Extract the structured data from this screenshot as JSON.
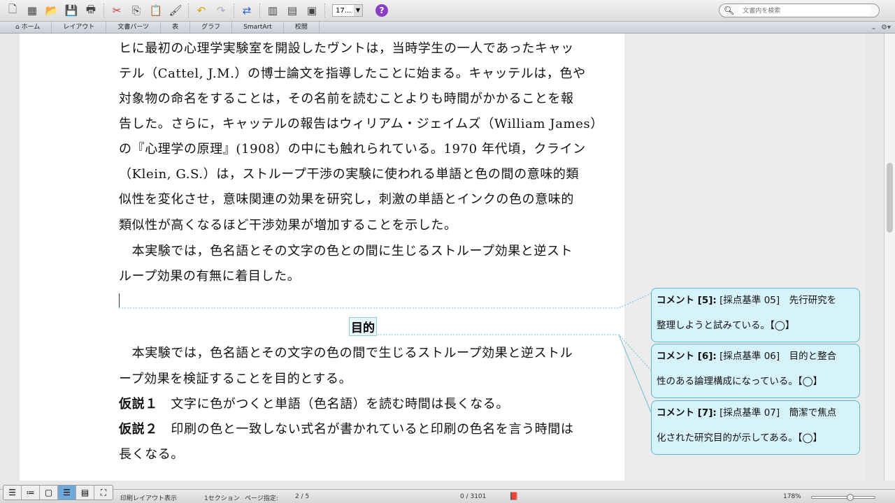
{
  "toolbar": {
    "font_size": "17...",
    "search_placeholder": "文書内を検索"
  },
  "ribbon": {
    "tabs": [
      "ホーム",
      "レイアウト",
      "文書パーツ",
      "表",
      "グラフ",
      "SmartArt",
      "校閲"
    ]
  },
  "document": {
    "lines": [
      "ヒに最初の心理学実験室を開設したヴントは，当時学生の一人であったキャッ",
      "テル（Cattel, J.M.）の博士論文を指導したことに始まる。キャッテルは，色や",
      "対象物の命名をすることは，その名前を読むことよりも時間がかかることを報",
      "告した。さらに，キャッテルの報告はウィリアム・ジェイムズ（William James）",
      "の『心理学の原理』(1908）の中にも触れられている。1970 年代頃，クライン",
      "（Klein, G.S.）は，ストループ干渉の実験に使われる単語と色の間の意味的類",
      "似性を変化させ，意味関連の効果を研究し，刺激の単語とインクの色の意味的",
      "類似性が高くなるほど干渉効果が増加することを示した。",
      "　本実験では，色名語とその文字の色との間に生じるストループ効果と逆スト",
      "ループ効果の有無に着目した。"
    ],
    "heading": "目的",
    "lines2": [
      "　本実験では，色名語とその文字の色の間で生じるストループ効果と逆ストル",
      "ープ効果を検証することを目的とする。"
    ],
    "hyp1_label": "仮説１",
    "hyp1_text": "　文字に色がつくと単語（色名語）を読む時間は長くなる。",
    "hyp2_label": "仮説２",
    "hyp2_text": "　印刷の色と一致しない式名が書かれていると印刷の色名を言う時間は",
    "hyp2_cont": "長くなる。"
  },
  "comments": [
    {
      "label": "コメント [5]:",
      "line1": "[採点基準 05]　先行研究を",
      "line2": "整理しようと試みている。【◯】"
    },
    {
      "label": "コメント [6]:",
      "line1": "[採点基準 06]　目的と整合",
      "line2": "性のある論理構成になっている。【◯】"
    },
    {
      "label": "コメント [7]:",
      "line1": "[採点基準 07]　簡潔で焦点",
      "line2": "化された研究目的が示してある。【◯】"
    }
  ],
  "status": {
    "view": "印刷レイアウト表示",
    "section": "1セクション",
    "page_label": "ページ指定:",
    "page": "2 / 5",
    "words": "0 / 3101",
    "zoom": "178%"
  }
}
